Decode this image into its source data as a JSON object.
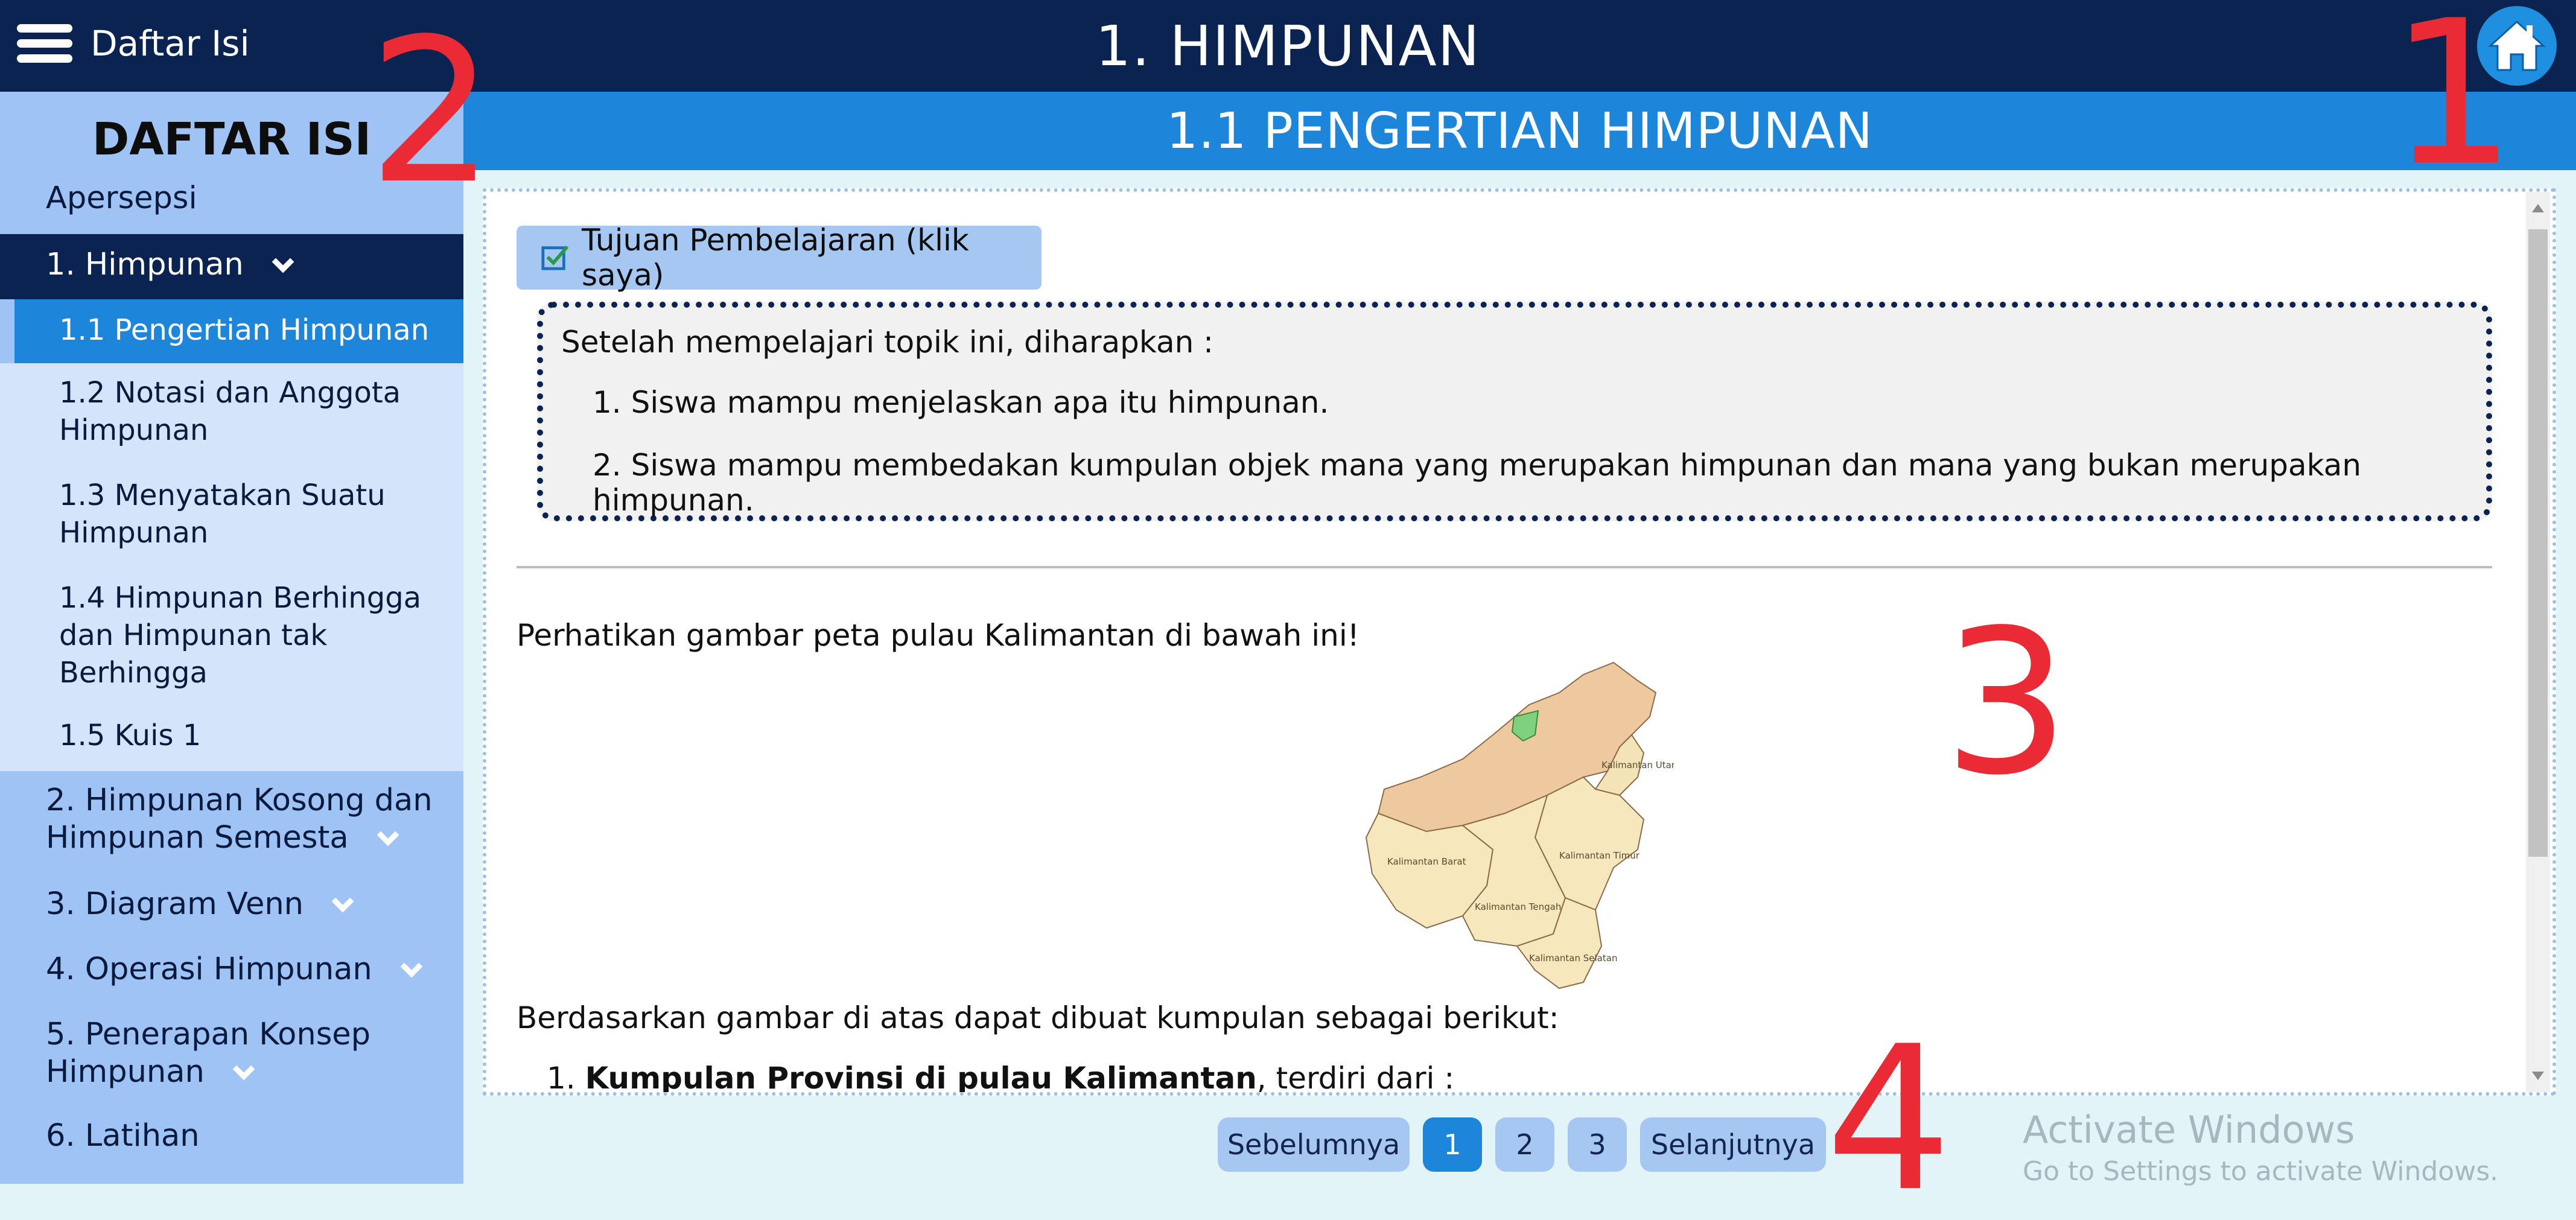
{
  "topbar": {
    "menu_label": "Daftar Isi",
    "title": "1. HIMPUNAN",
    "home_icon": "home-icon"
  },
  "annotations": [
    "1",
    "2",
    "3",
    "4"
  ],
  "sidebar": {
    "title": "DAFTAR ISI",
    "items": [
      {
        "label": "Apersepsi"
      },
      {
        "label": "1. Himpunan"
      },
      {
        "label": "1.1 Pengertian Himpunan"
      },
      {
        "label": "1.2 Notasi dan Anggota Himpunan"
      },
      {
        "label": "1.3 Menyatakan Suatu Himpunan"
      },
      {
        "label": "1.4 Himpunan Berhingga dan Himpunan tak Berhingga"
      },
      {
        "label": "1.5 Kuis 1"
      },
      {
        "label": "2. Himpunan Kosong dan Himpunan Semesta"
      },
      {
        "label": "3. Diagram Venn"
      },
      {
        "label": "4. Operasi Himpunan"
      },
      {
        "label": "5. Penerapan Konsep Himpunan"
      },
      {
        "label": "6. Latihan"
      }
    ]
  },
  "section": {
    "title": "1.1 PENGERTIAN HIMPUNAN"
  },
  "content": {
    "goals_button": "Tujuan Pembelajaran (klik saya)",
    "goals_intro": "Setelah mempelajari topik ini, diharapkan :",
    "goals": [
      "1. Siswa mampu menjelaskan apa itu himpunan.",
      "2. Siswa mampu membedakan kumpulan objek mana yang merupakan himpunan dan mana yang bukan merupakan himpunan."
    ],
    "map_intro": "Perhatikan gambar peta pulau Kalimantan di bawah ini!",
    "map_labels": [
      "Kalimantan Utara",
      "Kalimantan Barat",
      "Kalimantan Timur",
      "Kalimantan Tengah",
      "Kalimantan Selatan"
    ],
    "after_map": "Berdasarkan gambar di atas dapat dibuat kumpulan sebagai berikut:",
    "list_item_num": "1.",
    "list_item_bold": "Kumpulan Provinsi di pulau Kalimantan",
    "list_item_rest": ", terdiri dari :"
  },
  "pagination": {
    "prev": "Sebelumnya",
    "pages": [
      "1",
      "2",
      "3"
    ],
    "next": "Selanjutnya"
  },
  "watermark": {
    "title": "Activate Windows",
    "subtitle": "Go to Settings to activate Windows."
  },
  "colors": {
    "topbar": "#0b2350",
    "section_bar": "#1d86da",
    "sidebar": "#9ec3f4",
    "accent_annotation": "#ea2b35"
  }
}
